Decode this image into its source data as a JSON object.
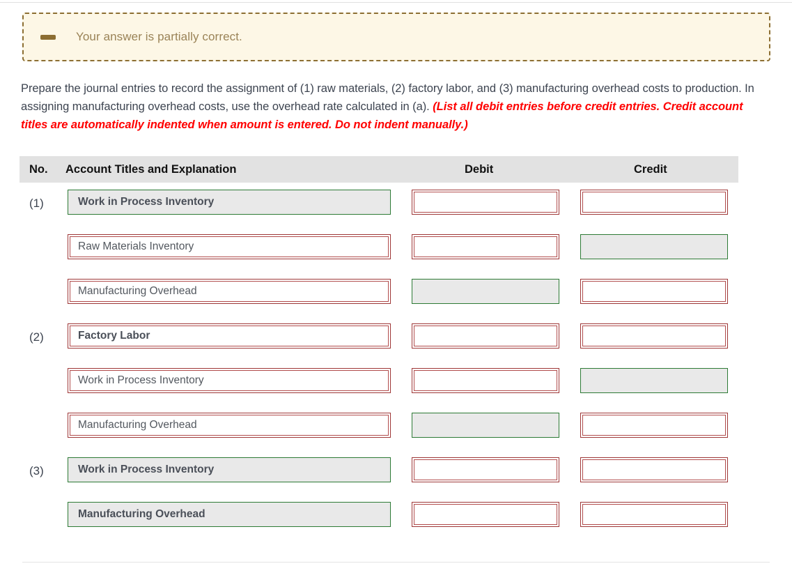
{
  "alert": {
    "icon": "minus-icon",
    "message": "Your answer is partially correct.",
    "bg_color": "#fdf7e6",
    "border_color": "#8c6e32",
    "text_color": "#9a8357"
  },
  "instructions": {
    "part1": "Prepare the journal entries to record the assignment of (1) raw materials, (2) factory labor, and (3) manufacturing overhead costs to production. In assigning manufacturing overhead costs, use the overhead rate calculated in (a). ",
    "part2": "(List all debit entries before credit entries. Credit account titles are automatically indented when amount is entered. Do not indent manually.)",
    "emphasis_color": "#ff0000"
  },
  "table": {
    "headers": {
      "no": "No.",
      "account": "Account Titles and Explanation",
      "debit": "Debit",
      "credit": "Credit"
    },
    "header_bg": "#e2e2e2",
    "correct_color": "#2d7a35",
    "incorrect_color": "#9e3737",
    "rows": [
      {
        "no": "(1)",
        "account": "Work in Process Inventory",
        "account_state": "correct",
        "account_bold": true,
        "debit": "",
        "debit_state": "incorrect",
        "credit": "",
        "credit_state": "incorrect"
      },
      {
        "no": "",
        "account": "Raw Materials Inventory",
        "account_state": "incorrect",
        "account_bold": false,
        "debit": "",
        "debit_state": "incorrect",
        "credit": "",
        "credit_state": "correct"
      },
      {
        "no": "",
        "account": "Manufacturing Overhead",
        "account_state": "incorrect",
        "account_bold": false,
        "debit": "",
        "debit_state": "correct",
        "credit": "",
        "credit_state": "incorrect"
      },
      {
        "no": "(2)",
        "account": "Factory Labor",
        "account_state": "incorrect",
        "account_bold": true,
        "debit": "",
        "debit_state": "incorrect",
        "credit": "",
        "credit_state": "incorrect"
      },
      {
        "no": "",
        "account": "Work in Process Inventory",
        "account_state": "incorrect",
        "account_bold": false,
        "debit": "",
        "debit_state": "incorrect",
        "credit": "",
        "credit_state": "correct"
      },
      {
        "no": "",
        "account": "Manufacturing Overhead",
        "account_state": "incorrect",
        "account_bold": false,
        "debit": "",
        "debit_state": "correct",
        "credit": "",
        "credit_state": "incorrect"
      },
      {
        "no": "(3)",
        "account": "Work in Process Inventory",
        "account_state": "correct",
        "account_bold": true,
        "debit": "",
        "debit_state": "incorrect",
        "credit": "",
        "credit_state": "incorrect"
      },
      {
        "no": "",
        "account": "Manufacturing Overhead",
        "account_state": "correct",
        "account_bold": true,
        "debit": "",
        "debit_state": "incorrect",
        "credit": "",
        "credit_state": "incorrect"
      }
    ]
  }
}
